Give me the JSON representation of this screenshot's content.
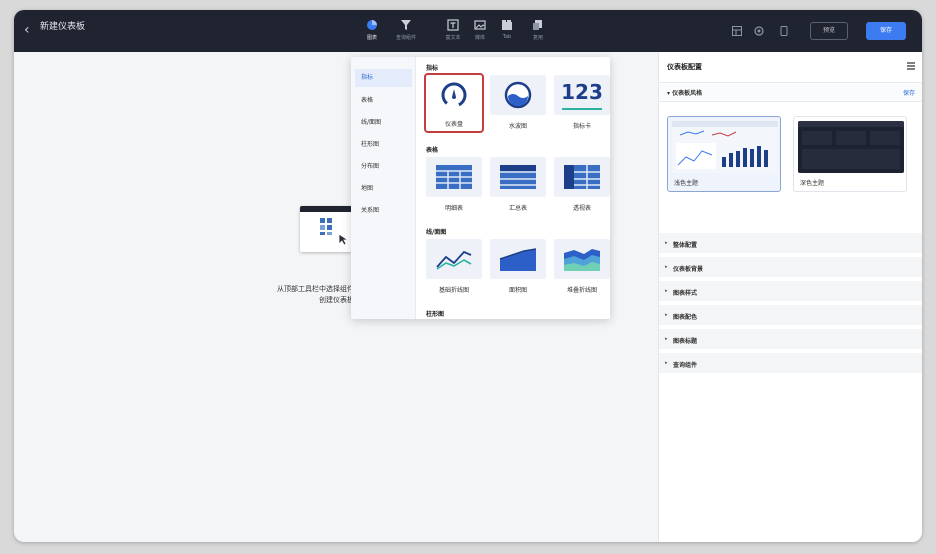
{
  "topbar": {
    "back_icon": "chevron-left-icon",
    "title": "新建仪表板",
    "subtitle": "",
    "tools": [
      {
        "label": "图表",
        "icon": "chart-pie-icon"
      },
      {
        "label": "查询组件",
        "icon": "filter-icon"
      },
      {
        "label": "富文本",
        "icon": "text-icon"
      },
      {
        "label": "媒体",
        "icon": "image-icon"
      },
      {
        "label": "Tab",
        "icon": "tab-icon"
      },
      {
        "label": "复用",
        "icon": "copy-icon"
      }
    ],
    "preview_label": "预览",
    "save_label": "保存",
    "accent": "#3d7bf0"
  },
  "canvas": {
    "empty_line1": "从顶部工具栏中选择组件",
    "empty_line2": "创建仪表板"
  },
  "picker": {
    "categories": [
      "指标",
      "表格",
      "线/面图",
      "柱形图",
      "分布图",
      "地图",
      "关系图"
    ],
    "sections": [
      {
        "title": "指标",
        "items": [
          {
            "name": "仪表盘",
            "icon": "gauge-icon"
          },
          {
            "name": "水波图",
            "icon": "liquid-fill-icon"
          },
          {
            "name": "指标卡",
            "icon": "kpi-card-icon",
            "glyph": "123"
          }
        ]
      },
      {
        "title": "表格",
        "items": [
          {
            "name": "明细表",
            "icon": "detail-table-icon"
          },
          {
            "name": "汇总表",
            "icon": "summary-table-icon"
          },
          {
            "name": "透视表",
            "icon": "pivot-table-icon"
          }
        ]
      },
      {
        "title": "线/面图",
        "items": [
          {
            "name": "基础折线图",
            "icon": "line-chart-icon"
          },
          {
            "name": "面积图",
            "icon": "area-chart-icon"
          },
          {
            "name": "堆叠折线图",
            "icon": "stacked-line-icon"
          }
        ]
      },
      {
        "title": "柱形图",
        "items": []
      }
    ],
    "selected_color": "#c43d3d"
  },
  "panel": {
    "title": "仪表板配置",
    "style_header": "仪表板风格",
    "style_action": "保存",
    "themes": [
      {
        "name": "浅色主题"
      },
      {
        "name": "深色主题"
      }
    ],
    "sections": [
      "整体配置",
      "仪表板背景",
      "图表样式",
      "图表配色",
      "图表标题",
      "查询组件"
    ]
  }
}
